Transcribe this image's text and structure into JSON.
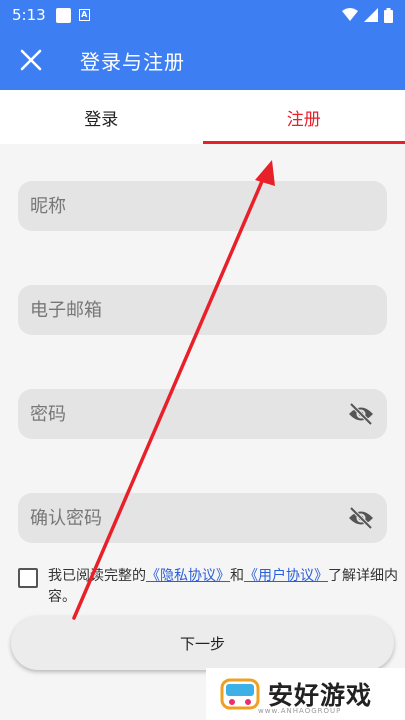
{
  "status_bar": {
    "time": "5:13"
  },
  "app_bar": {
    "title": "登录与注册"
  },
  "tabs": [
    {
      "label": "登录",
      "active": false
    },
    {
      "label": "注册",
      "active": true
    }
  ],
  "form": {
    "nickname_placeholder": "昵称",
    "email_placeholder": "电子邮箱",
    "password_placeholder": "密码",
    "confirm_password_placeholder": "确认密码"
  },
  "agreement": {
    "prefix": "我已阅读完整的",
    "privacy_link": "《隐私协议》",
    "conjunction": "和",
    "user_link": "《用户协议》",
    "suffix": "了解详细内容。"
  },
  "next_button": {
    "label": "下一步"
  },
  "watermark": {
    "text": "安好游戏",
    "sub": "www.ANHAOGROUP"
  },
  "colors": {
    "primary": "#3d7ff2",
    "accent_red": "#e8202a",
    "field_bg": "#e4e4e4",
    "link": "#2b5fd9"
  }
}
